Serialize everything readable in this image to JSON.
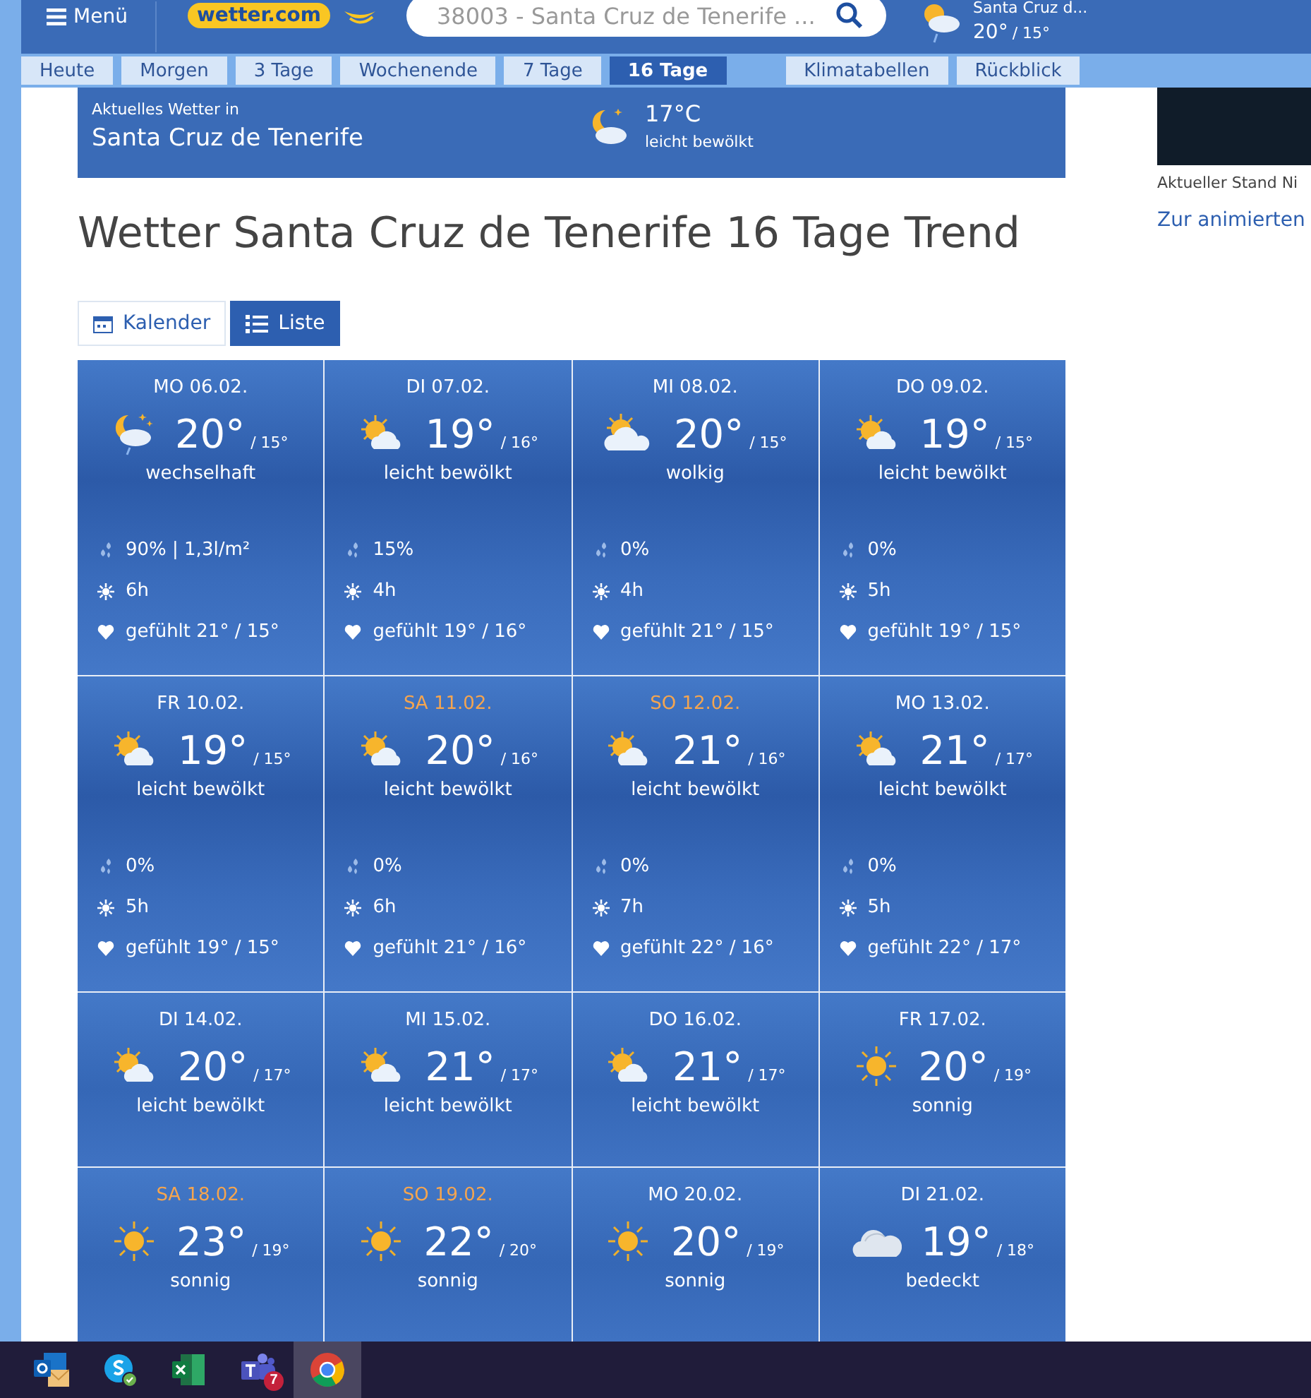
{
  "header": {
    "menu_label": "Menü",
    "logo": "wetter.com",
    "search": {
      "value": "38003 - Santa Cruz de Tenerife ..."
    },
    "current_place": "Santa Cruz d...",
    "current_high": "20°",
    "current_low": "/ 15°"
  },
  "nav_tabs": [
    {
      "label": "Heute",
      "selected": false
    },
    {
      "label": "Morgen",
      "selected": false
    },
    {
      "label": "3 Tage",
      "selected": false
    },
    {
      "label": "Wochenende",
      "selected": false
    },
    {
      "label": "7 Tage",
      "selected": false
    },
    {
      "label": "16 Tage",
      "selected": true
    }
  ],
  "nav_extra": [
    {
      "label": "Klimatabellen"
    },
    {
      "label": "Rückblick"
    }
  ],
  "current": {
    "caption": "Aktuelles Wetter in",
    "place": "Santa Cruz de Tenerife",
    "temp": "17°C",
    "desc": "leicht bewölkt"
  },
  "title": "Wetter Santa Cruz de Tenerife 16 Tage Trend",
  "view_toggle": [
    {
      "label": "Kalender",
      "kind": "calendar",
      "selected": false
    },
    {
      "label": "Liste",
      "kind": "list",
      "selected": true
    }
  ],
  "days": [
    {
      "date": "MO 06.02.",
      "weekend": false,
      "kind": "moon-cloud-rain",
      "high": "20°",
      "low": "/ 15°",
      "desc": "wechselhaft",
      "rain": "90% | 1,3l/m²",
      "sun": "6h",
      "felt": "gefühlt 21° / 15°"
    },
    {
      "date": "DI 07.02.",
      "weekend": false,
      "kind": "sun-cloud",
      "high": "19°",
      "low": "/ 16°",
      "desc": "leicht bewölkt",
      "rain": "15%",
      "sun": "4h",
      "felt": "gefühlt 19° / 16°"
    },
    {
      "date": "MI 08.02.",
      "weekend": false,
      "kind": "cloud-sun",
      "high": "20°",
      "low": "/ 15°",
      "desc": "wolkig",
      "rain": "0%",
      "sun": "4h",
      "felt": "gefühlt 21° / 15°"
    },
    {
      "date": "DO 09.02.",
      "weekend": false,
      "kind": "sun-cloud",
      "high": "19°",
      "low": "/ 15°",
      "desc": "leicht bewölkt",
      "rain": "0%",
      "sun": "5h",
      "felt": "gefühlt 19° / 15°"
    },
    {
      "date": "FR 10.02.",
      "weekend": false,
      "kind": "sun-cloud",
      "high": "19°",
      "low": "/ 15°",
      "desc": "leicht bewölkt",
      "rain": "0%",
      "sun": "5h",
      "felt": "gefühlt 19° / 15°"
    },
    {
      "date": "SA 11.02.",
      "weekend": true,
      "kind": "sun-cloud",
      "high": "20°",
      "low": "/ 16°",
      "desc": "leicht bewölkt",
      "rain": "0%",
      "sun": "6h",
      "felt": "gefühlt 21° / 16°"
    },
    {
      "date": "SO 12.02.",
      "weekend": true,
      "kind": "sun-cloud",
      "high": "21°",
      "low": "/ 16°",
      "desc": "leicht bewölkt",
      "rain": "0%",
      "sun": "7h",
      "felt": "gefühlt 22° / 16°"
    },
    {
      "date": "MO 13.02.",
      "weekend": false,
      "kind": "sun-cloud",
      "high": "21°",
      "low": "/ 17°",
      "desc": "leicht bewölkt",
      "rain": "0%",
      "sun": "5h",
      "felt": "gefühlt 22° / 17°"
    },
    {
      "date": "DI 14.02.",
      "weekend": false,
      "kind": "sun-cloud",
      "high": "20°",
      "low": "/ 17°",
      "desc": "leicht bewölkt"
    },
    {
      "date": "MI 15.02.",
      "weekend": false,
      "kind": "sun-cloud",
      "high": "21°",
      "low": "/ 17°",
      "desc": "leicht bewölkt"
    },
    {
      "date": "DO 16.02.",
      "weekend": false,
      "kind": "sun-cloud",
      "high": "21°",
      "low": "/ 17°",
      "desc": "leicht bewölkt"
    },
    {
      "date": "FR 17.02.",
      "weekend": false,
      "kind": "sun",
      "high": "20°",
      "low": "/ 19°",
      "desc": "sonnig"
    },
    {
      "date": "SA 18.02.",
      "weekend": true,
      "kind": "sun",
      "high": "23°",
      "low": "/ 19°",
      "desc": "sonnig"
    },
    {
      "date": "SO 19.02.",
      "weekend": true,
      "kind": "sun",
      "high": "22°",
      "low": "/ 20°",
      "desc": "sonnig"
    },
    {
      "date": "MO 20.02.",
      "weekend": false,
      "kind": "sun",
      "high": "20°",
      "low": "/ 19°",
      "desc": "sonnig"
    },
    {
      "date": "DI 21.02.",
      "weekend": false,
      "kind": "overcast",
      "high": "19°",
      "low": "/ 18°",
      "desc": "bedeckt"
    }
  ],
  "sidebar": {
    "caption": "Aktueller Stand Ni",
    "link": "Zur animierten"
  },
  "taskbar": [
    {
      "kind": "outlook",
      "selected": false
    },
    {
      "kind": "skype",
      "selected": false
    },
    {
      "kind": "excel",
      "selected": false
    },
    {
      "kind": "teams",
      "selected": false,
      "badge": "7"
    },
    {
      "kind": "chrome",
      "selected": true
    }
  ]
}
